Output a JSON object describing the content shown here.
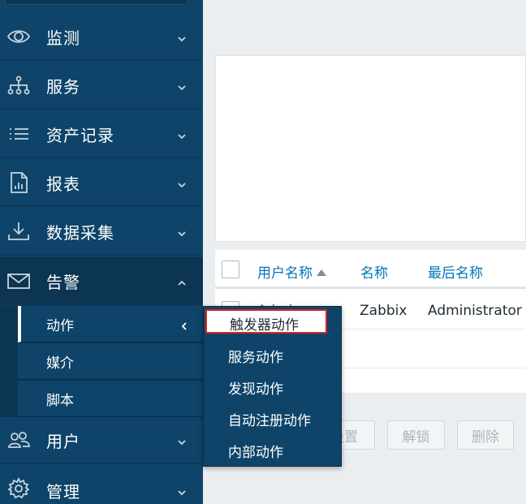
{
  "sidebar": {
    "items": [
      {
        "label": "监测",
        "icon": "eye-icon"
      },
      {
        "label": "服务",
        "icon": "sitemap-icon"
      },
      {
        "label": "资产记录",
        "icon": "list-icon"
      },
      {
        "label": "报表",
        "icon": "report-icon"
      },
      {
        "label": "数据采集",
        "icon": "download-icon"
      },
      {
        "label": "告警",
        "icon": "envelope-icon"
      },
      {
        "label": "用户",
        "icon": "users-icon"
      },
      {
        "label": "管理",
        "icon": "gear-icon"
      }
    ],
    "alerts_submenu": [
      {
        "label": "动作"
      },
      {
        "label": "媒介"
      },
      {
        "label": "脚本"
      }
    ]
  },
  "actions_popup": {
    "items": [
      {
        "label": "触发器动作"
      },
      {
        "label": "服务动作"
      },
      {
        "label": "发现动作"
      },
      {
        "label": "自动注册动作"
      },
      {
        "label": "内部动作"
      }
    ]
  },
  "table": {
    "headers": {
      "username": "用户名称",
      "name": "名称",
      "surname": "最后名称"
    },
    "rows": [
      {
        "username": "Admin",
        "name": "Zabbix",
        "surname": "Administrator"
      }
    ]
  },
  "buttons": {
    "settings": "设置",
    "unblock": "解锁",
    "delete": "删除"
  },
  "colors": {
    "sidebar_bg": "#0e4469",
    "link": "#0275b8",
    "highlight_border": "#e02020"
  }
}
